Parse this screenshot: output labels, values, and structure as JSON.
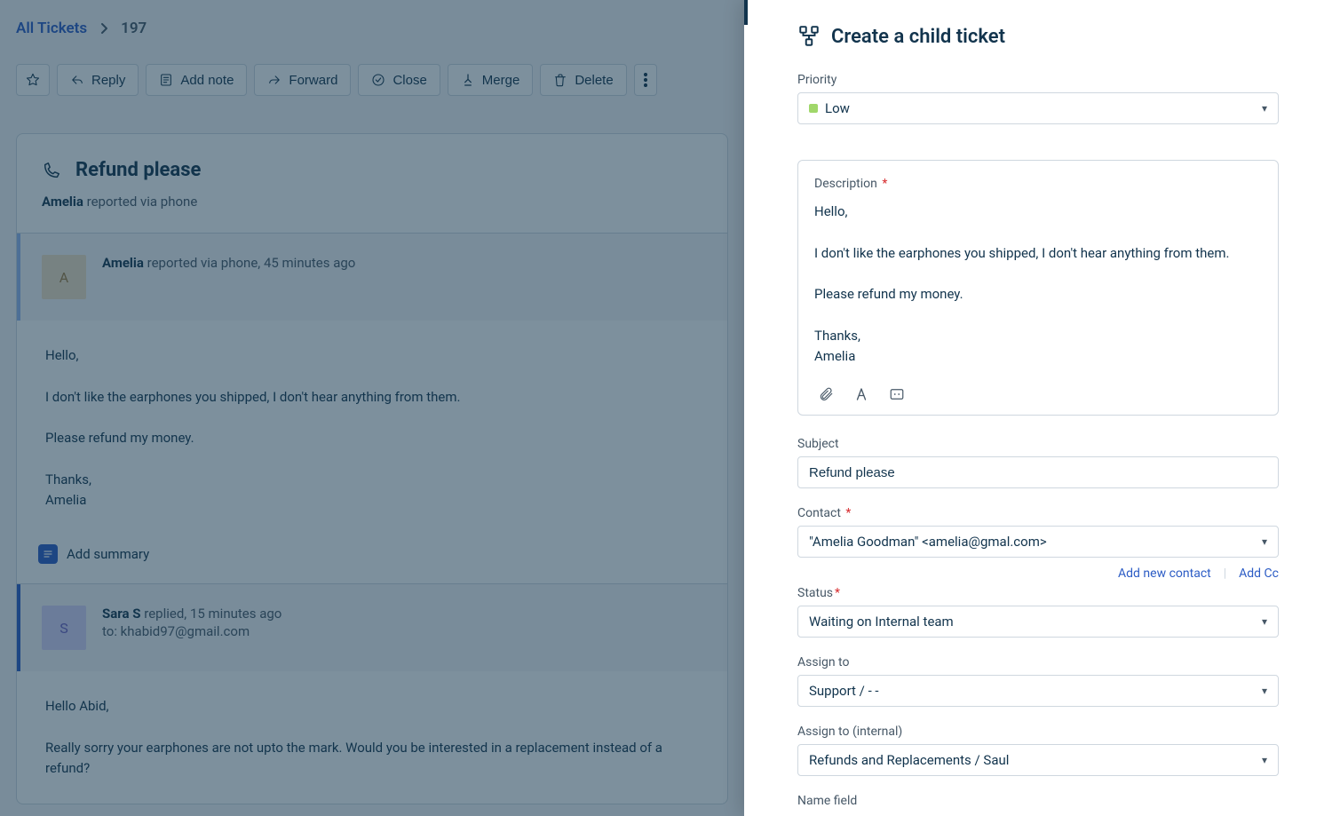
{
  "breadcrumb": {
    "root": "All Tickets",
    "id": "197"
  },
  "toolbar": {
    "reply": "Reply",
    "add_note": "Add note",
    "forward": "Forward",
    "close": "Close",
    "merge": "Merge",
    "delete": "Delete"
  },
  "ticket": {
    "title": "Refund please",
    "reporter_name": "Amelia",
    "reported_meta": "reported via phone",
    "messages": [
      {
        "avatar_initial": "A",
        "name": "Amelia",
        "meta": "reported via phone, 45 minutes ago",
        "body_html": "Hello,<br><br>I don't like the earphones you shipped, I don't hear anything from them.<br><br>Please refund my money.<br><br>Thanks,<br>Amelia"
      },
      {
        "avatar_initial": "S",
        "name": "Sara S",
        "meta": "replied, 15 minutes ago",
        "to_line": "to: khabid97@gmail.com",
        "body_html": "Hello Abid,<br><br>Really sorry your earphones are not upto the mark. Would you be interested in a replacement instead of a refund?"
      }
    ],
    "add_summary": "Add summary"
  },
  "panel": {
    "title": "Create a child ticket",
    "priority_label": "Priority",
    "priority_value": "Low",
    "description_label": "Description",
    "description_html": "Hello,<br><br>I don't like the earphones you shipped, I don't hear anything from them.<br><br>Please refund my money.<br><br>Thanks,<br>Amelia",
    "subject_label": "Subject",
    "subject_value": "Refund please",
    "contact_label": "Contact",
    "contact_value": "\"Amelia Goodman\" <amelia@gmal.com>",
    "add_new_contact": "Add new contact",
    "add_cc": "Add Cc",
    "status_label": "Status",
    "status_value": "Waiting on Internal team",
    "assign_label": "Assign to",
    "assign_value": "Support / - -",
    "assign_internal_label": "Assign to (internal)",
    "assign_internal_value": "Refunds and Replacements / Saul",
    "name_field_label": "Name field"
  }
}
